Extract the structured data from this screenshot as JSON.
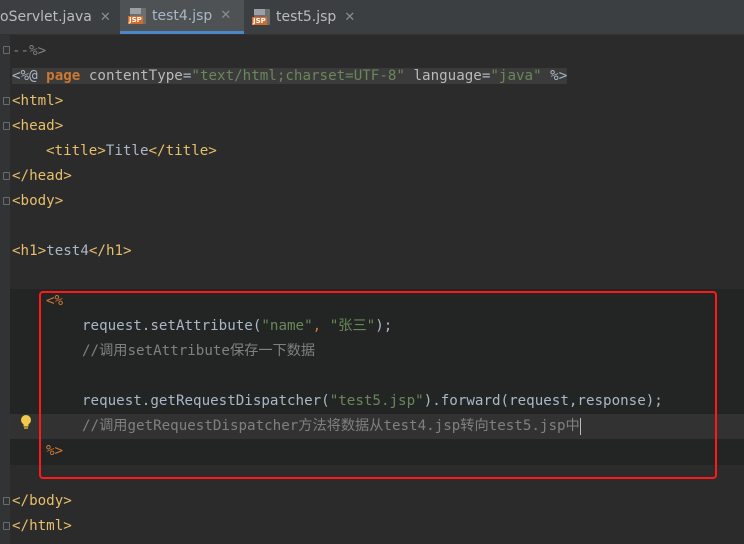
{
  "tabs": [
    {
      "label": "oServlet.java",
      "active": false
    },
    {
      "label": "test4.jsp",
      "active": true,
      "icon": "jsp-file-icon"
    },
    {
      "label": "test5.jsp",
      "active": false,
      "icon": "jsp-file-icon"
    }
  ],
  "tab_close_glyph": "✕",
  "code": {
    "l1": "--%>",
    "l2": {
      "open": "<%@ ",
      "page": "page",
      "a1": "contentType",
      "eq1": "=",
      "v1": "\"text/html;charset=UTF-8\"",
      "a2": "language",
      "eq2": "=",
      "v2": "\"java\"",
      "close": " %>"
    },
    "l3": "<html>",
    "l4": "<head>",
    "l5": {
      "open": "<title>",
      "text": "Title",
      "close": "</title>"
    },
    "l6": "</head>",
    "l7": "<body>",
    "l9": {
      "open": "<h1>",
      "text": "test4",
      "close": "</h1>"
    },
    "l11": "<%",
    "l12": {
      "obj": "request.setAttribute(",
      "s1": "\"name\"",
      "comma": ", ",
      "s2": "\"张三\"",
      "end": ");"
    },
    "l13": "//调用setAttribute保存一下数据",
    "l15": {
      "obj": "request.getRequestDispatcher(",
      "s1": "\"test5.jsp\"",
      "mid": ").forward(request,response);"
    },
    "l16": "//调用getRequestDispatcher方法将数据从test4.jsp转向test5.jsp中",
    "l17": "%>",
    "l19": "</body>",
    "l20": "</html>"
  },
  "colors": {
    "annotation_box": "#ff1a1a",
    "tag": "#e8bf6a",
    "string": "#6a8759",
    "comment": "#808080"
  }
}
